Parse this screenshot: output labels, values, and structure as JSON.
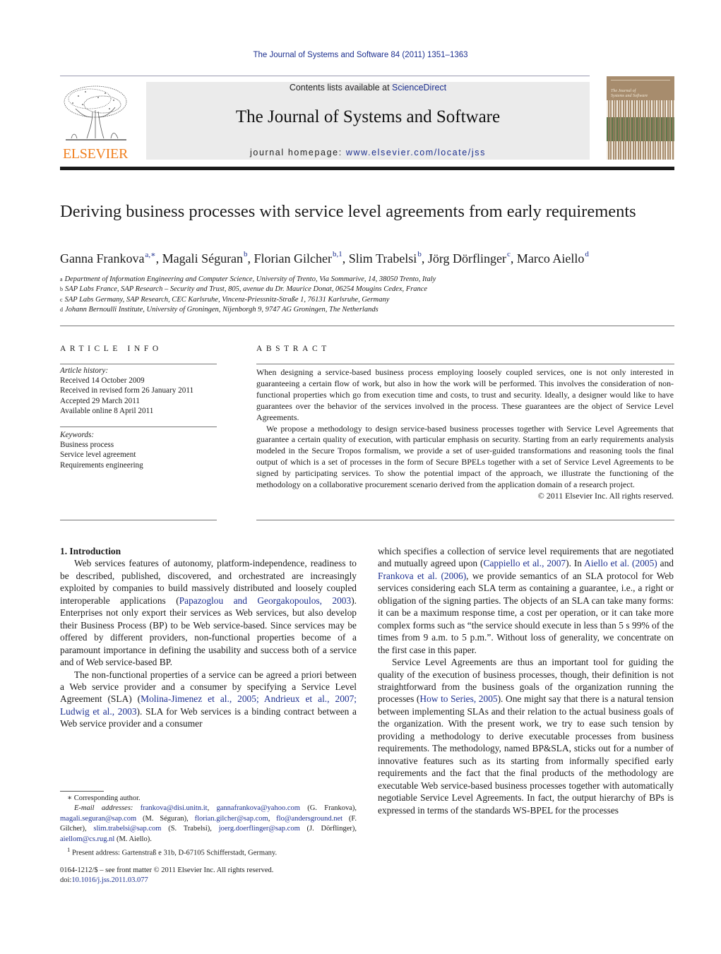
{
  "header": {
    "journal_reference": "The Journal of Systems and Software 84 (2011) 1351–1363",
    "contents_prefix": "Contents lists available at ",
    "contents_link": "ScienceDirect",
    "journal_title": "The Journal of Systems and Software",
    "homepage_prefix": "journal homepage: ",
    "homepage_link": "www.elsevier.com/locate/jss",
    "publisher_logo_text": "ELSEVIER",
    "cover_title_line1": "The Journal of",
    "cover_title_line2": "Systems and Software",
    "colors": {
      "link": "#1c2f8f",
      "publisher_orange": "#f07f1e",
      "banner_gray": "#ebebeb",
      "cover_brown": "#a78c6d"
    }
  },
  "article": {
    "title": "Deriving business processes with service level agreements from early requirements",
    "authors": [
      {
        "name": "Ganna Frankova",
        "marks": "a,∗"
      },
      {
        "name": "Magali Séguran",
        "marks": "b"
      },
      {
        "name": "Florian Gilcher",
        "marks": "b,1"
      },
      {
        "name": "Slim Trabelsi",
        "marks": "b"
      },
      {
        "name": "Jörg Dörflinger",
        "marks": "c"
      },
      {
        "name": "Marco Aiello",
        "marks": "d"
      }
    ],
    "affiliations": [
      {
        "mark": "a",
        "text": "Department of Information Engineering and Computer Science, University of Trento, Via Sommarive, 14, 38050 Trento, Italy"
      },
      {
        "mark": "b",
        "text": "SAP Labs France, SAP Research – Security and Trust, 805, avenue du Dr. Maurice Donat, 06254 Mougins Cedex, France"
      },
      {
        "mark": "c",
        "text": "SAP Labs Germany, SAP Research, CEC Karlsruhe, Vincenz-Priessnitz-Straße 1, 76131 Karlsruhe, Germany"
      },
      {
        "mark": "d",
        "text": "Johann Bernoulli Institute, University of Groningen, Nijenborgh 9, 9747 AG Groningen, The Netherlands"
      }
    ]
  },
  "article_info": {
    "heading": "ARTICLE INFO",
    "history_label": "Article history:",
    "history": [
      "Received 14 October 2009",
      "Received in revised form 26 January 2011",
      "Accepted 29 March 2011",
      "Available online 8 April 2011"
    ],
    "keywords_label": "Keywords:",
    "keywords": [
      "Business process",
      "Service level agreement",
      "Requirements engineering"
    ]
  },
  "abstract": {
    "heading": "ABSTRACT",
    "paragraphs": [
      "When designing a service-based business process employing loosely coupled services, one is not only interested in guaranteeing a certain flow of work, but also in how the work will be performed. This involves the consideration of non-functional properties which go from execution time and costs, to trust and security. Ideally, a designer would like to have guarantees over the behavior of the services involved in the process. These guarantees are the object of Service Level Agreements.",
      "We propose a methodology to design service-based business processes together with Service Level Agreements that guarantee a certain quality of execution, with particular emphasis on security. Starting from an early requirements analysis modeled in the Secure Tropos formalism, we provide a set of user-guided transformations and reasoning tools the final output of which is a set of processes in the form of Secure BPELs together with a set of Service Level Agreements to be signed by participating services. To show the potential impact of the approach, we illustrate the functioning of the methodology on a collaborative procurement scenario derived from the application domain of a research project."
    ],
    "copyright": "© 2011 Elsevier Inc. All rights reserved."
  },
  "body": {
    "section_title": "1.  Introduction",
    "left": {
      "p1_a": "Web services features of autonomy, platform-independence, readiness to be described, published, discovered, and orchestrated are increasingly exploited by companies to build massively distributed and loosely coupled interoperable applications (",
      "p1_cite": "Papazoglou and Georgakopoulos, 2003",
      "p1_b": "). Enterprises not only export their services as Web services, but also develop their Business Process (BP) to be Web service-based. Since services may be offered by different providers, non-functional properties become of a paramount importance in defining the usability and success both of a service and of Web service-based BP.",
      "p2_a": "The non-functional properties of a service can be agreed a priori between a Web service provider and a consumer by specifying a Service Level Agreement (SLA) (",
      "p2_cite": "Molina-Jimenez et al., 2005; Andrieux et al., 2007; Ludwig et al., 2003",
      "p2_b": "). SLA for Web services is a binding contract between a Web service provider and a consumer"
    },
    "right": {
      "p1_a": "which specifies a collection of service level requirements that are negotiated and mutually agreed upon (",
      "p1_cite1": "Cappiello et al., 2007",
      "p1_b": "). In ",
      "p1_cite2": "Aiello et al. (2005)",
      "p1_c": " and ",
      "p1_cite3": "Frankova et al. (2006)",
      "p1_d": ", we provide semantics of an SLA protocol for Web services considering each SLA term as containing a guarantee, i.e., a right or obligation of the signing parties. The objects of an SLA can take many forms: it can be a maximum response time, a cost per operation, or it can take more complex forms such as “the service should execute in less than 5 s 99% of the times from 9 a.m. to 5 p.m.”. Without loss of generality, we concentrate on the first case in this paper.",
      "p2_a": "Service Level Agreements are thus an important tool for guiding the quality of the execution of business processes, though, their definition is not straightforward from the business goals of the organization running the processes (",
      "p2_cite": "How to Series, 2005",
      "p2_b": "). One might say that there is a natural tension between implementing SLAs and their relation to the actual business goals of the organization. With the present work, we try to ease such tension by providing a methodology to derive executable processes from business requirements. The methodology, named BP&SLA, sticks out for a number of innovative features such as its starting from informally specified early requirements and the fact that the final products of the methodology are executable Web service-based business processes together with automatically negotiable Service Level Agreements. In fact, the output hierarchy of BPs is expressed in terms of the standards WS-BPEL for the processes"
    }
  },
  "footnotes": {
    "corresponding": "∗ Corresponding author.",
    "email_label": "E-mail addresses:",
    "emails": [
      {
        "addr": "frankova@disi.unitn.it",
        "after": ", "
      },
      {
        "addr": "gannafrankova@yahoo.com",
        "after": " (G. Frankova), "
      },
      {
        "addr": "magali.seguran@sap.com",
        "after": " (M. Séguran), "
      },
      {
        "addr": "florian.gilcher@sap.com",
        "after": ", "
      },
      {
        "addr": "flo@andersground.net",
        "after": " (F. Gilcher), "
      },
      {
        "addr": "slim.trabelsi@sap.com",
        "after": " (S. Trabelsi), "
      },
      {
        "addr": "joerg.doerflinger@sap.com",
        "after": " (J. Dörflinger), "
      },
      {
        "addr": "aiellom@cs.rug.nl",
        "after": " (M. Aiello)."
      }
    ],
    "present_address_mark": "1",
    "present_address": "Present address: Gartenstraß e 31b, D-67105 Schifferstadt, Germany."
  },
  "front_matter": {
    "issn_line": "0164-1212/$ – see front matter © 2011 Elsevier Inc. All rights reserved.",
    "doi_prefix": "doi:",
    "doi": "10.1016/j.jss.2011.03.077"
  }
}
